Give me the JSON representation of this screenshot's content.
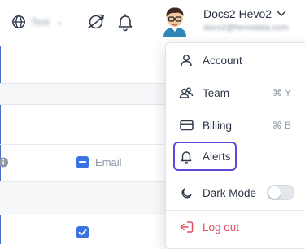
{
  "topbar": {
    "workspace_name": "Test",
    "user_name": "Docs2 Hevo2",
    "user_email": "docs2@hevodata.com"
  },
  "table": {
    "email_label": "Email"
  },
  "menu": {
    "items": [
      {
        "label": "Account",
        "shortcut": "",
        "icon": "user-icon"
      },
      {
        "label": "Team",
        "shortcut": "⌘ Y",
        "icon": "team-icon"
      },
      {
        "label": "Billing",
        "shortcut": "⌘ B",
        "icon": "credit-card-icon"
      },
      {
        "label": "Alerts",
        "shortcut": "",
        "icon": "bell-icon"
      }
    ],
    "dark_mode_label": "Dark Mode",
    "dark_mode_on": false,
    "logout_label": "Log out"
  },
  "colors": {
    "highlight": "#5b4bd6",
    "logout": "#e3505a",
    "checkbox": "#3b74e0"
  }
}
